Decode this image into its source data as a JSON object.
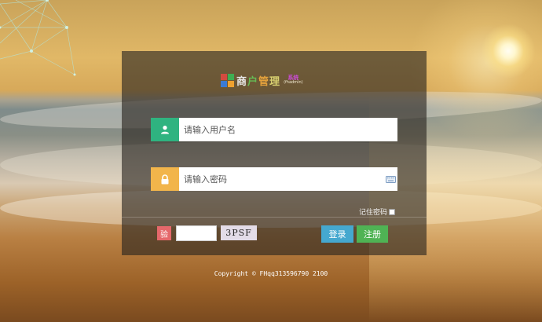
{
  "logo": {
    "title_chars": [
      "商",
      "户",
      "管",
      "理"
    ],
    "subtitle_top": "系统",
    "subtitle_bottom": "(fhadmin)",
    "grid_colors": [
      "#d34b3f",
      "#3fae52",
      "#3a7bd5",
      "#f0a22f"
    ]
  },
  "login": {
    "username_placeholder": "请输入用户名",
    "password_placeholder": "请输入密码",
    "remember_label": "记住密码",
    "remember_checked": false,
    "captcha_icon_label": "验",
    "captcha_value": "",
    "captcha_image_text": "3PSF",
    "login_label": "登录",
    "register_label": "注册"
  },
  "colors": {
    "user_icon_bg": "#2fb380",
    "lock_icon_bg": "#f2b54b",
    "captcha_icon_bg": "#e5686b",
    "login_btn": "#45a8cf",
    "register_btn": "#4fb354"
  },
  "footer": {
    "copyright": "Copyright © FHqq313596790 2100"
  }
}
